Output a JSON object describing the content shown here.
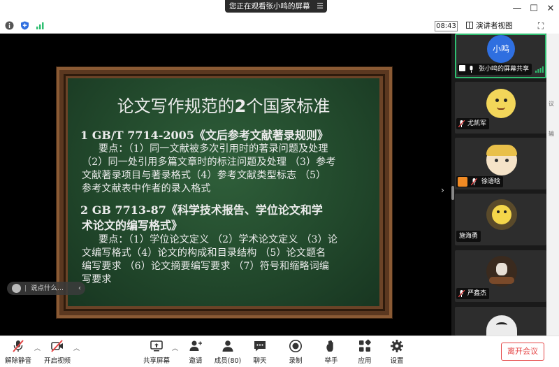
{
  "titlebar": {
    "share_notice": "您正在观看张小鸣的屏幕",
    "menu_glyph": "☰",
    "minimize": "—",
    "maximize": "☐",
    "close": "✕"
  },
  "infobar": {
    "clock": "08:43",
    "view_mode": "演讲者视图"
  },
  "slide": {
    "title_pre": "论文写作规范的",
    "title_num": "2",
    "title_post": "个国家标准",
    "s1_heading": "1   GB/T 7714-2005《文后参考文献著录规则》",
    "s1_line1": "要点：（1）同一文献被多次引用时的著录问题及处理",
    "s1_line2": "（2）同一处引用多篇文章时的标注问题及处理 （3）参考",
    "s1_line3": "文献著录项目与著录格式（4）参考文献类型标志 （5）",
    "s1_line4": "参考文献表中作者的录入格式",
    "s2_heading_line1": "2   GB 7713-87《科学技术报告、学位论文和学",
    "s2_heading_line2": "术论文的编写格式》",
    "s2_line1": "要点：（1）学位论文定义 （2）学术论文定义 （3）论",
    "s2_line2": "文编写格式（4）论文的构成和目录结构 （5）论文题名",
    "s2_line3": "编写要求 （6）论文摘要编写要求 （7）符号和缩略词编",
    "s2_line4": "写要求"
  },
  "chat": {
    "placeholder": "说点什么..."
  },
  "participants": [
    {
      "name": "张小鸣的屏幕共享",
      "avatar_text": "小鸣",
      "avatar_color": "#2f6fe0"
    },
    {
      "name": "尤凯军"
    },
    {
      "name": "徐语晗"
    },
    {
      "name": "施海勇"
    },
    {
      "name": "严鑫杰"
    },
    {
      "name": ""
    }
  ],
  "right_strip": {
    "text1": "议",
    "text2": "输"
  },
  "toolbar": {
    "mute": "解除静音",
    "video": "开启视频",
    "share": "共享屏幕",
    "invite": "邀请",
    "members": "成员(80)",
    "chat": "聊天",
    "record": "录制",
    "raise_hand": "举手",
    "apps": "应用",
    "settings": "设置",
    "leave": "离开会议"
  },
  "colors": {
    "accent_green": "#2fbf71",
    "danger_red": "#e54545",
    "chalkboard": "#22492c",
    "frame_wood": "#6b4327"
  }
}
